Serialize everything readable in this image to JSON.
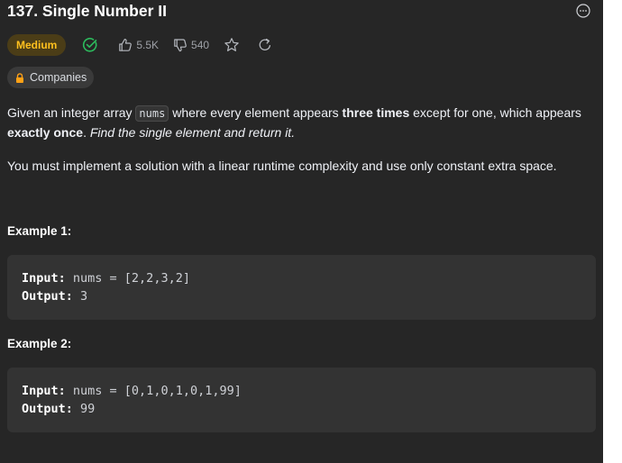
{
  "problem": {
    "title": "137. Single Number II",
    "difficulty": "Medium",
    "likes": "5.5K",
    "dislikes": "540",
    "companies_label": "Companies"
  },
  "description": {
    "p1_a": "Given an integer array ",
    "p1_code": "nums",
    "p1_b": " where every element appears ",
    "p1_bold1": "three times",
    "p1_c": " except for one, which appears ",
    "p1_bold2": "exactly once",
    "p1_d": ". ",
    "p1_em": "Find the single element and return it.",
    "p2": "You must implement a solution with a linear runtime complexity and use only constant extra space."
  },
  "examples": [
    {
      "label": "Example 1:",
      "input_key": "Input:",
      "input_val": " nums = [2,2,3,2]",
      "output_key": "Output:",
      "output_val": " 3"
    },
    {
      "label": "Example 2:",
      "input_key": "Input:",
      "input_val": " nums = [0,1,0,1,0,1,99]",
      "output_key": "Output:",
      "output_val": " 99"
    }
  ],
  "colors": {
    "panel_bg": "#262626",
    "medium": "#ffc01e",
    "solved": "#2cbb5d",
    "example_bg": "#333333"
  },
  "icons": [
    "more-options-icon",
    "solved-check-icon",
    "thumbs-up-icon",
    "thumbs-down-icon",
    "star-icon",
    "redo-icon",
    "lock-icon"
  ]
}
